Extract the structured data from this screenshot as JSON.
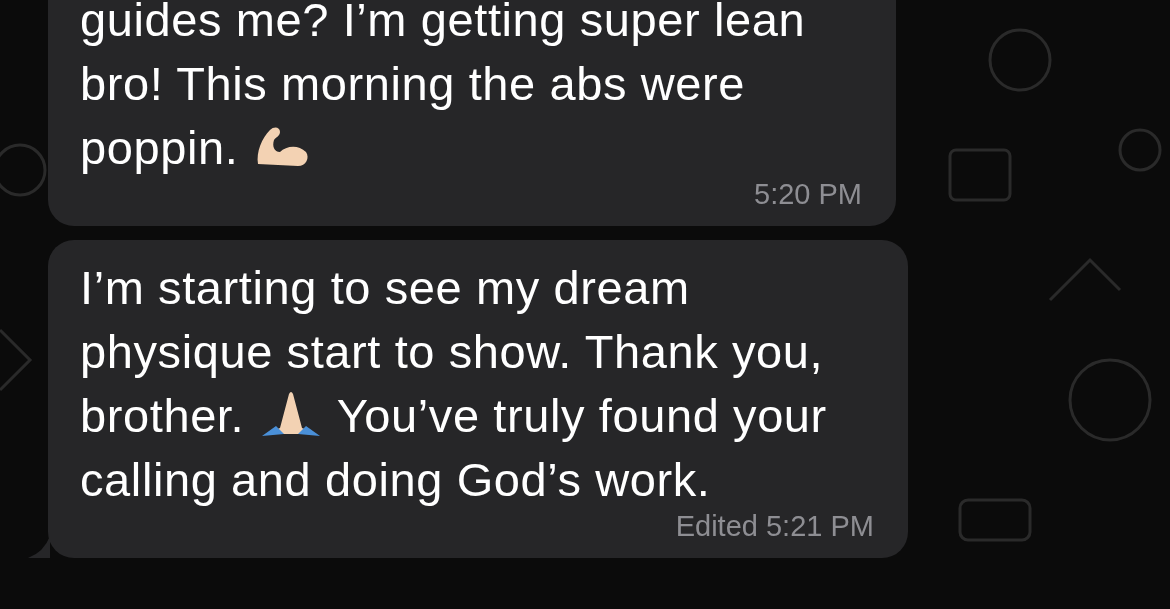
{
  "messages": [
    {
      "parts": [
        {
          "kind": "text",
          "text": "guides me? I’m getting super lean bro! This morning the abs were poppin. "
        },
        {
          "kind": "arm"
        }
      ],
      "edited": false,
      "time": "5:20 PM",
      "tail": false
    },
    {
      "parts": [
        {
          "kind": "text",
          "text": "I’m starting to see my dream physique start to show. Thank you, brother. "
        },
        {
          "kind": "hands"
        },
        {
          "kind": "text",
          "text": " You’ve truly found your calling and doing God’s work."
        }
      ],
      "edited": true,
      "edited_label": "Edited",
      "time": "5:21 PM",
      "tail": true
    }
  ]
}
